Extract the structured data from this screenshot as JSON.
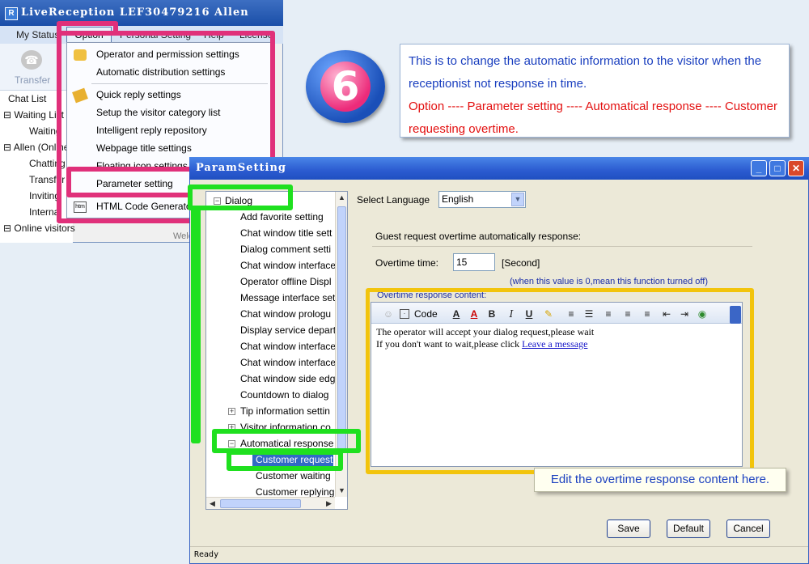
{
  "main_window": {
    "title": "LiveReception  LEF30479216 Allen",
    "menu": [
      "My Status",
      "Option",
      "Personal Setting",
      "Help",
      "License"
    ],
    "toolbar": {
      "transfer_label": "Transfer"
    },
    "chat_list": {
      "header": "Chat List",
      "items": [
        "Waiting List",
        "Waiting",
        "Allen (Online)",
        "Chatting",
        "Transfer",
        "Inviting",
        "Internal",
        "Online visitors"
      ]
    },
    "hidden_tab": "Welcome"
  },
  "option_menu": {
    "items": [
      "Operator and permission settings",
      "Automatic distribution settings",
      "Quick reply settings",
      "Setup the visitor category list",
      "Intelligent reply repository",
      "Webpage title settings",
      "Floating icon settings",
      "Parameter setting",
      "HTML Code Generator"
    ]
  },
  "badge": {
    "number": "6"
  },
  "info_box": {
    "blue_text": "This is to change the automatic information to the visitor when the receptionist not response in time.",
    "red_text": "Option ---- Parameter setting ----  Automatical response ---- Customer requesting overtime."
  },
  "dialog": {
    "title": "ParamSetting",
    "tree": [
      "Dialog",
      "Add favorite setting",
      "Chat window title sett",
      "Dialog comment setti",
      "Chat window interface",
      "Operator offline Displ",
      "Message interface sett",
      "Chat window prologu",
      "Display service depart",
      "Chat window interface",
      "Chat window interface",
      "Chat window side edg",
      "Countdown to dialog",
      "Tip information settin",
      "Visitor information co",
      "Automatical response",
      "Customer requesti",
      "Customer waiting",
      "Customer replying"
    ],
    "language_label": "Select Language",
    "language_value": "English",
    "group_heading": "Guest request overtime automatically response:",
    "overtime_label": "Overtime time:",
    "overtime_value": "15",
    "overtime_unit": "[Second]",
    "overtime_hint": "(when this value is 0,mean this function turned off)",
    "content_label": "Overtime response content:",
    "editor": {
      "code_button": "Code",
      "line1": "The operator will accept your dialog request,please wait",
      "line2_prefix": "If you don't want to wait,please click ",
      "link_text": "Leave a message"
    },
    "callout": "Edit the overtime response content here.",
    "buttons": {
      "save": "Save",
      "default": "Default",
      "cancel": "Cancel"
    },
    "status": "Ready"
  },
  "colors": {
    "highlight_pink": "#e0307a",
    "highlight_green": "#1fe01f",
    "highlight_yellow": "#f2c40c",
    "accent_blue": "#1a3fbf",
    "accent_red": "#e31010"
  }
}
